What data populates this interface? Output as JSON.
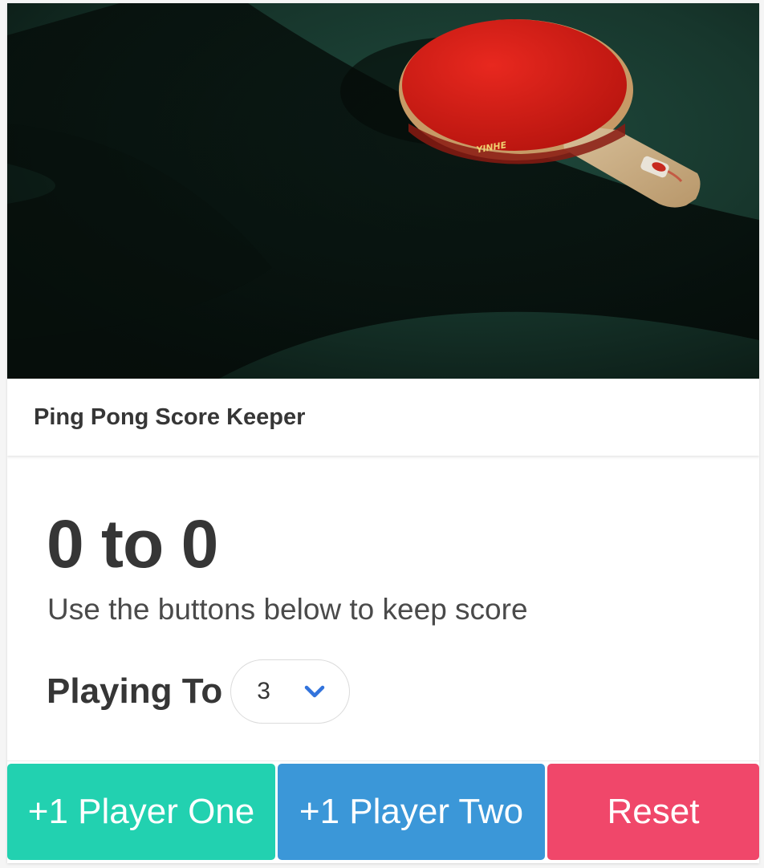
{
  "header": {
    "title": "Ping Pong Score Keeper"
  },
  "score": {
    "player_one": "0",
    "separator": "to",
    "player_two": "0",
    "display": "0 to 0"
  },
  "subtitle": "Use the buttons below to keep score",
  "playing_to": {
    "label": "Playing To",
    "selected": "3"
  },
  "buttons": {
    "player_one": "+1 Player One",
    "player_two": "+1 Player Two",
    "reset": "Reset"
  },
  "paddle_text": "YINHE",
  "colors": {
    "player_one": "#22d1b0",
    "player_two": "#3b97d8",
    "reset": "#f0476a",
    "table": "#16342b",
    "paddle": "#d31f1a"
  },
  "icons": {
    "select_arrow": "chevron-down-icon"
  }
}
